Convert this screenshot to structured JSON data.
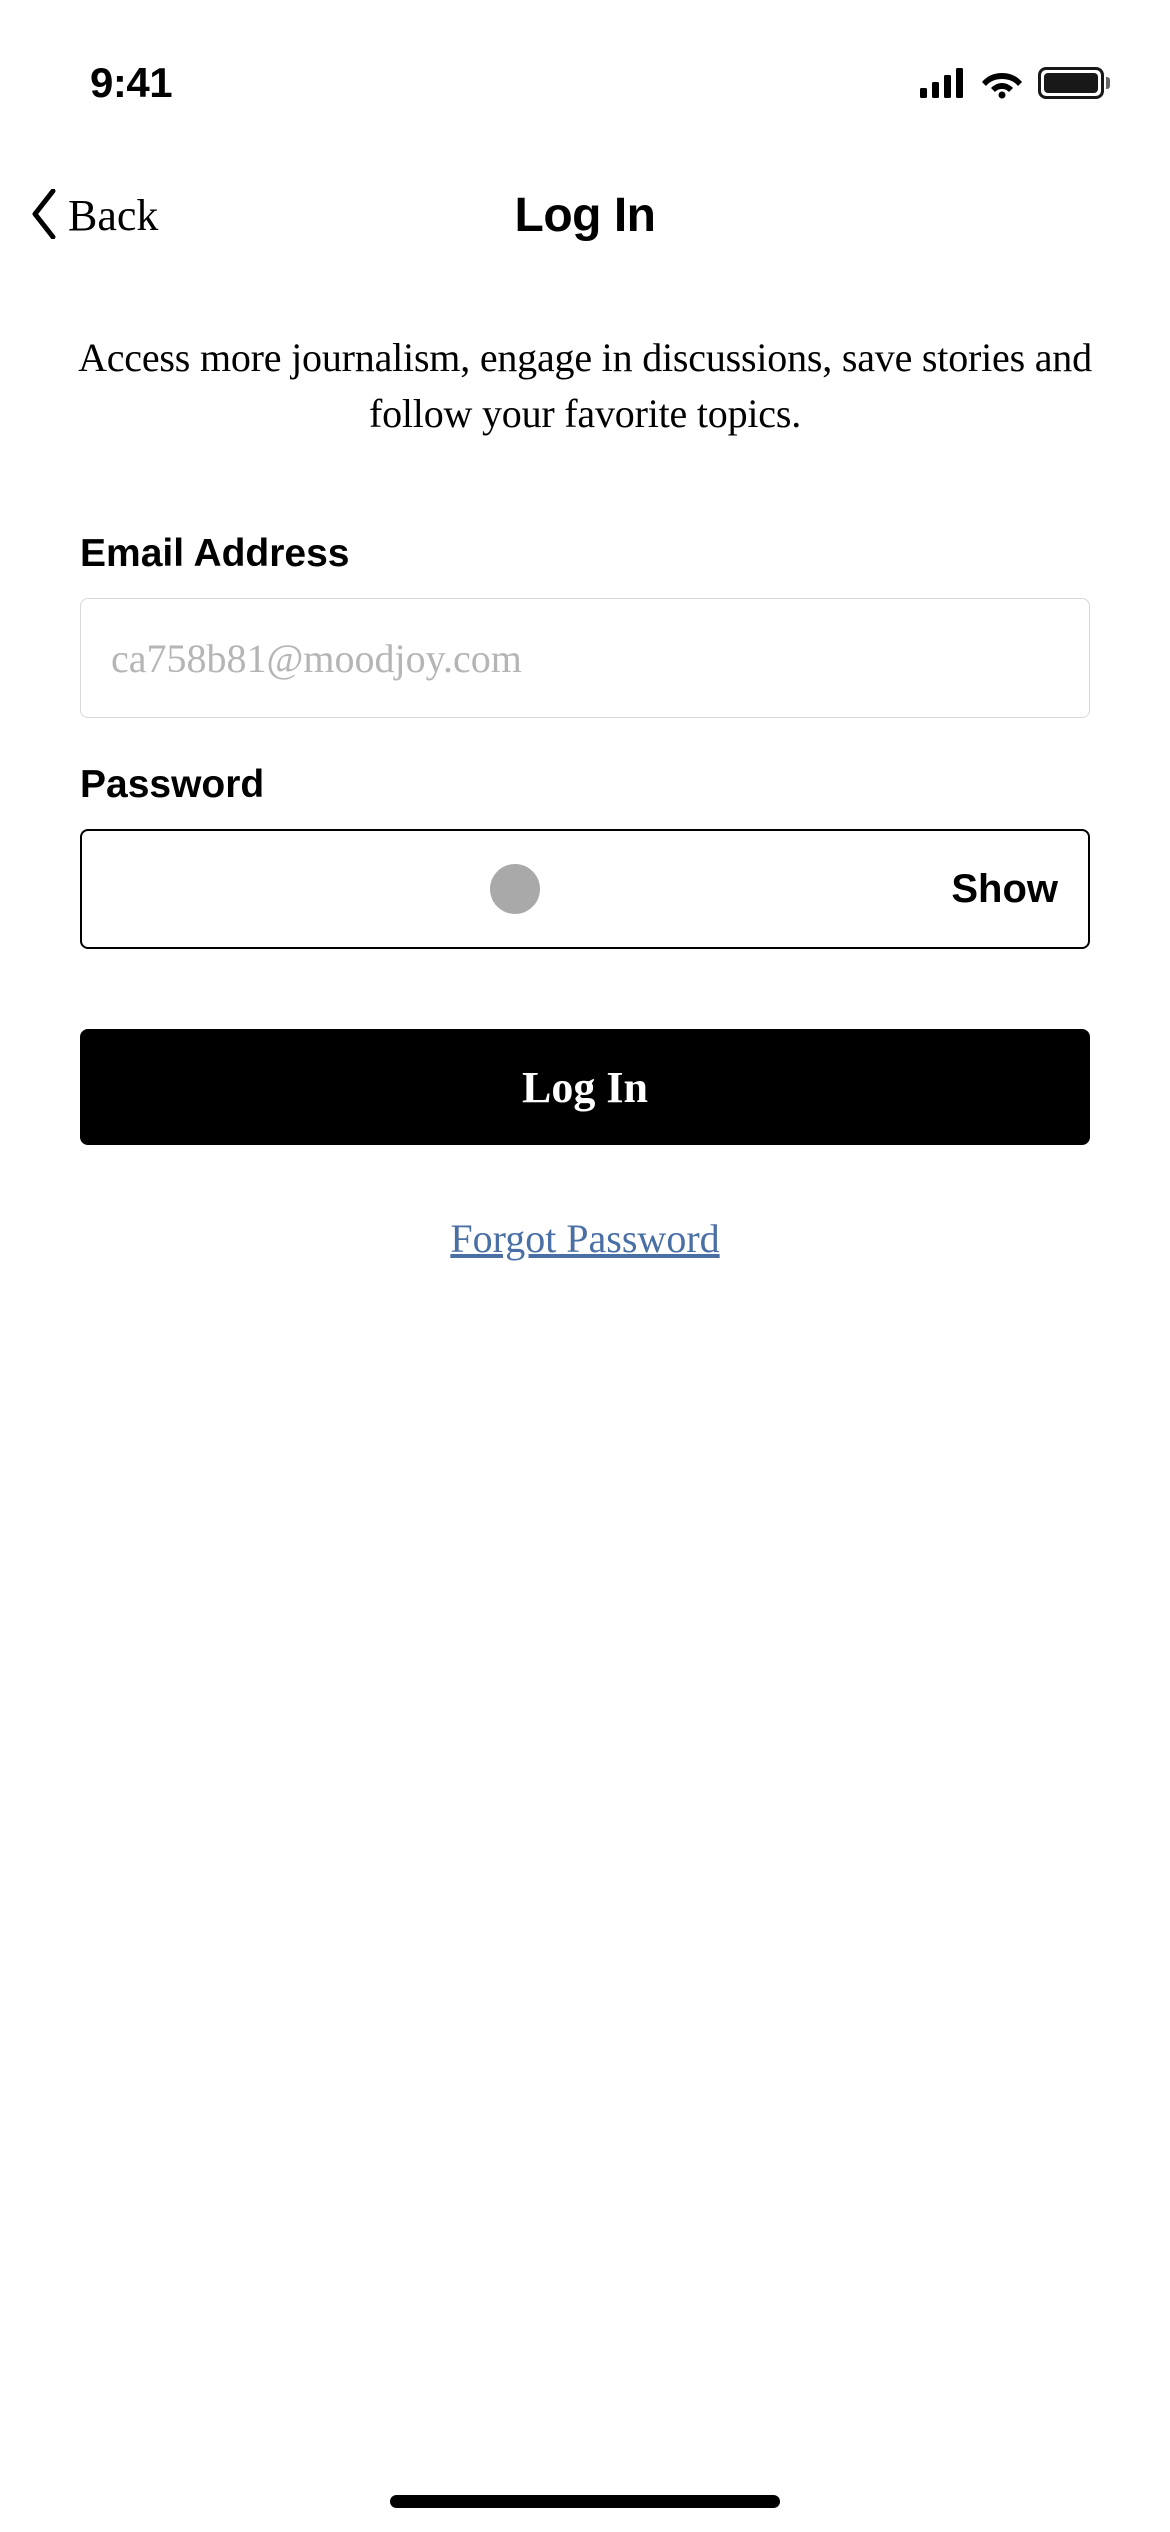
{
  "status": {
    "time": "9:41"
  },
  "nav": {
    "back_label": "Back",
    "title": "Log In"
  },
  "subtitle": "Access more journalism, engage in discussions, save stories and follow your favorite topics.",
  "form": {
    "email_label": "Email Address",
    "email_placeholder": "ca758b81@moodjoy.com",
    "email_value": "",
    "password_label": "Password",
    "password_value": "•",
    "show_label": "Show",
    "login_button": "Log In",
    "forgot_link": "Forgot Password"
  }
}
